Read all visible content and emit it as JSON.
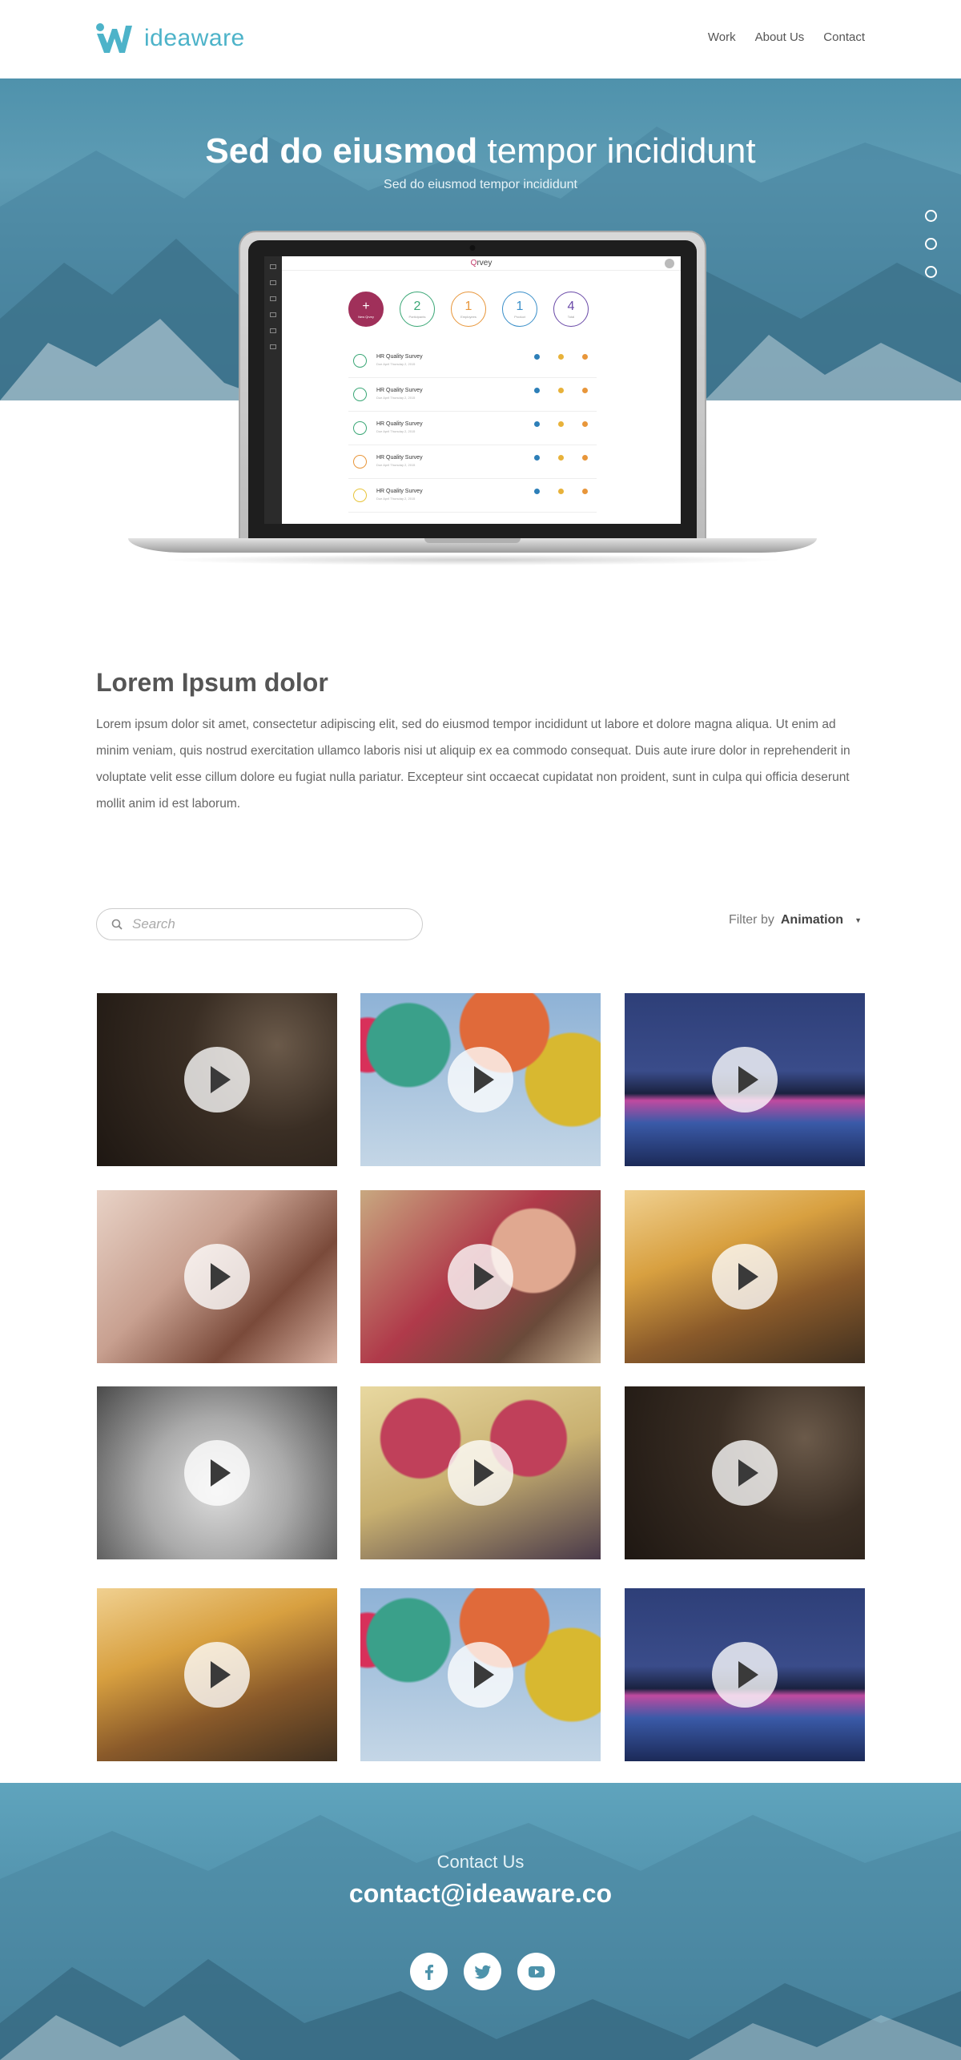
{
  "brand": {
    "name": "ideaware"
  },
  "nav": {
    "items": [
      "Work",
      "About Us",
      "Contact"
    ]
  },
  "hero": {
    "title_bold": "Sed do eiusmod",
    "title_light": "tempor incididunt",
    "subtitle": "Sed do eiusmod tempor incididunt",
    "slides": 3
  },
  "app": {
    "name_q": "Q",
    "name_rest": "rvey",
    "stats": [
      {
        "value": "+",
        "label": "New Qrvey",
        "color": "#a0305a"
      },
      {
        "value": "2",
        "label": "Participants",
        "color": "#3aa776"
      },
      {
        "value": "1",
        "label": "Employees",
        "color": "#e8963a"
      },
      {
        "value": "1",
        "label": "Product",
        "color": "#3a8fc9"
      },
      {
        "value": "4",
        "label": "Total",
        "color": "#6a4aa8"
      }
    ],
    "surveys": [
      {
        "title": "HR Quality Survey",
        "date": "Due April Thursday 2, 2015",
        "color": "#3aa776"
      },
      {
        "title": "HR Quality Survey",
        "date": "Due April Thursday 2, 2015",
        "color": "#3aa776"
      },
      {
        "title": "HR Quality Survey",
        "date": "Due April Thursday 2, 2015",
        "color": "#3aa776"
      },
      {
        "title": "HR Quality Survey",
        "date": "Due April Thursday 2, 2015",
        "color": "#e8963a"
      },
      {
        "title": "HR Quality Survey",
        "date": "Due April Thursday 2, 2015",
        "color": "#e8c43a"
      }
    ]
  },
  "intro": {
    "title": "Lorem Ipsum dolor",
    "body": "Lorem ipsum dolor sit amet, consectetur adipiscing elit, sed do eiusmod tempor incididunt ut labore et dolore magna aliqua. Ut enim ad minim veniam, quis nostrud exercitation ullamco laboris nisi ut aliquip ex ea commodo consequat. Duis aute irure dolor in reprehenderit in voluptate velit esse cillum dolore eu fugiat nulla pariatur. Excepteur sint occaecat cupidatat non proident, sunt in culpa qui officia deserunt mollit anim id est laborum."
  },
  "search": {
    "placeholder": "Search"
  },
  "filter": {
    "label": "Filter by",
    "value": "Animation"
  },
  "videos": [
    {
      "theme": "portrait-dark"
    },
    {
      "theme": "balloons"
    },
    {
      "theme": "city-night"
    },
    {
      "theme": "bicycle"
    },
    {
      "theme": "radio"
    },
    {
      "theme": "bus"
    },
    {
      "theme": "face-bw"
    },
    {
      "theme": "sunglasses"
    },
    {
      "theme": "portrait-dark"
    },
    {
      "theme": "bus"
    },
    {
      "theme": "balloons"
    },
    {
      "theme": "city-night"
    }
  ],
  "footer": {
    "label": "Contact Us",
    "email": "contact@ideaware.co",
    "socials": [
      "facebook-icon",
      "twitter-icon",
      "youtube-icon"
    ]
  }
}
